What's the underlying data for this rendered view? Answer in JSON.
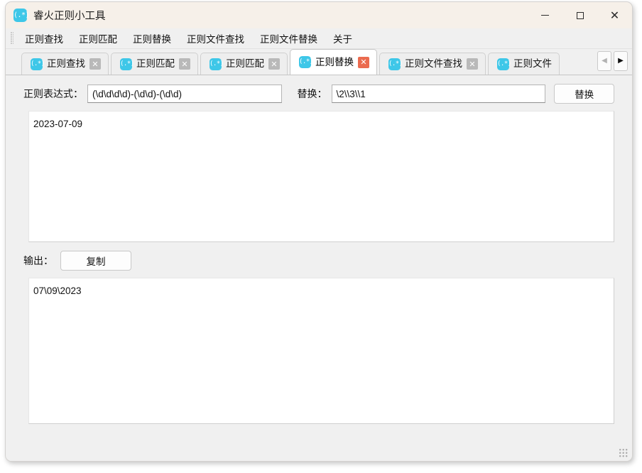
{
  "window": {
    "title": "睿火正则小工具",
    "icon": "app-regex-icon",
    "icon_glyph": "(.*)",
    "controls": {
      "minimize": "−",
      "maximize": "□",
      "close": "✕"
    }
  },
  "menubar": {
    "items": [
      {
        "label": "正则查找"
      },
      {
        "label": "正则匹配"
      },
      {
        "label": "正则替换"
      },
      {
        "label": "正则文件查找"
      },
      {
        "label": "正则文件替换"
      },
      {
        "label": "关于"
      }
    ]
  },
  "tabs": {
    "items": [
      {
        "label": "正则查找",
        "active": false,
        "close": "✕"
      },
      {
        "label": "正则匹配",
        "active": false,
        "close": "✕"
      },
      {
        "label": "正则匹配",
        "active": false,
        "close": "✕"
      },
      {
        "label": "正则替换",
        "active": true,
        "close": "✕"
      },
      {
        "label": "正则文件查找",
        "active": false,
        "close": "✕"
      },
      {
        "label": "正则文件",
        "active": false,
        "close": "✕"
      }
    ],
    "nav_prev": "◀",
    "nav_next": "▶",
    "icon_glyph": "(.*)"
  },
  "panel": {
    "expression_label": "正则表达式：",
    "expression_value": "(\\d\\d\\d\\d)-(\\d\\d)-(\\d\\d)",
    "replace_label": "替换：",
    "replace_value": "\\2\\\\3\\\\1",
    "replace_button": "替换",
    "input_text": "2023-07-09",
    "output_label": "输出：",
    "copy_button": "复制",
    "output_text": "07\\09\\2023"
  },
  "colors": {
    "accent": "#3ec7e8",
    "active_tab_close": "#eb6b4f",
    "titlebar_bg": "#f6f0e9",
    "window_bg": "#f0f0f0"
  }
}
